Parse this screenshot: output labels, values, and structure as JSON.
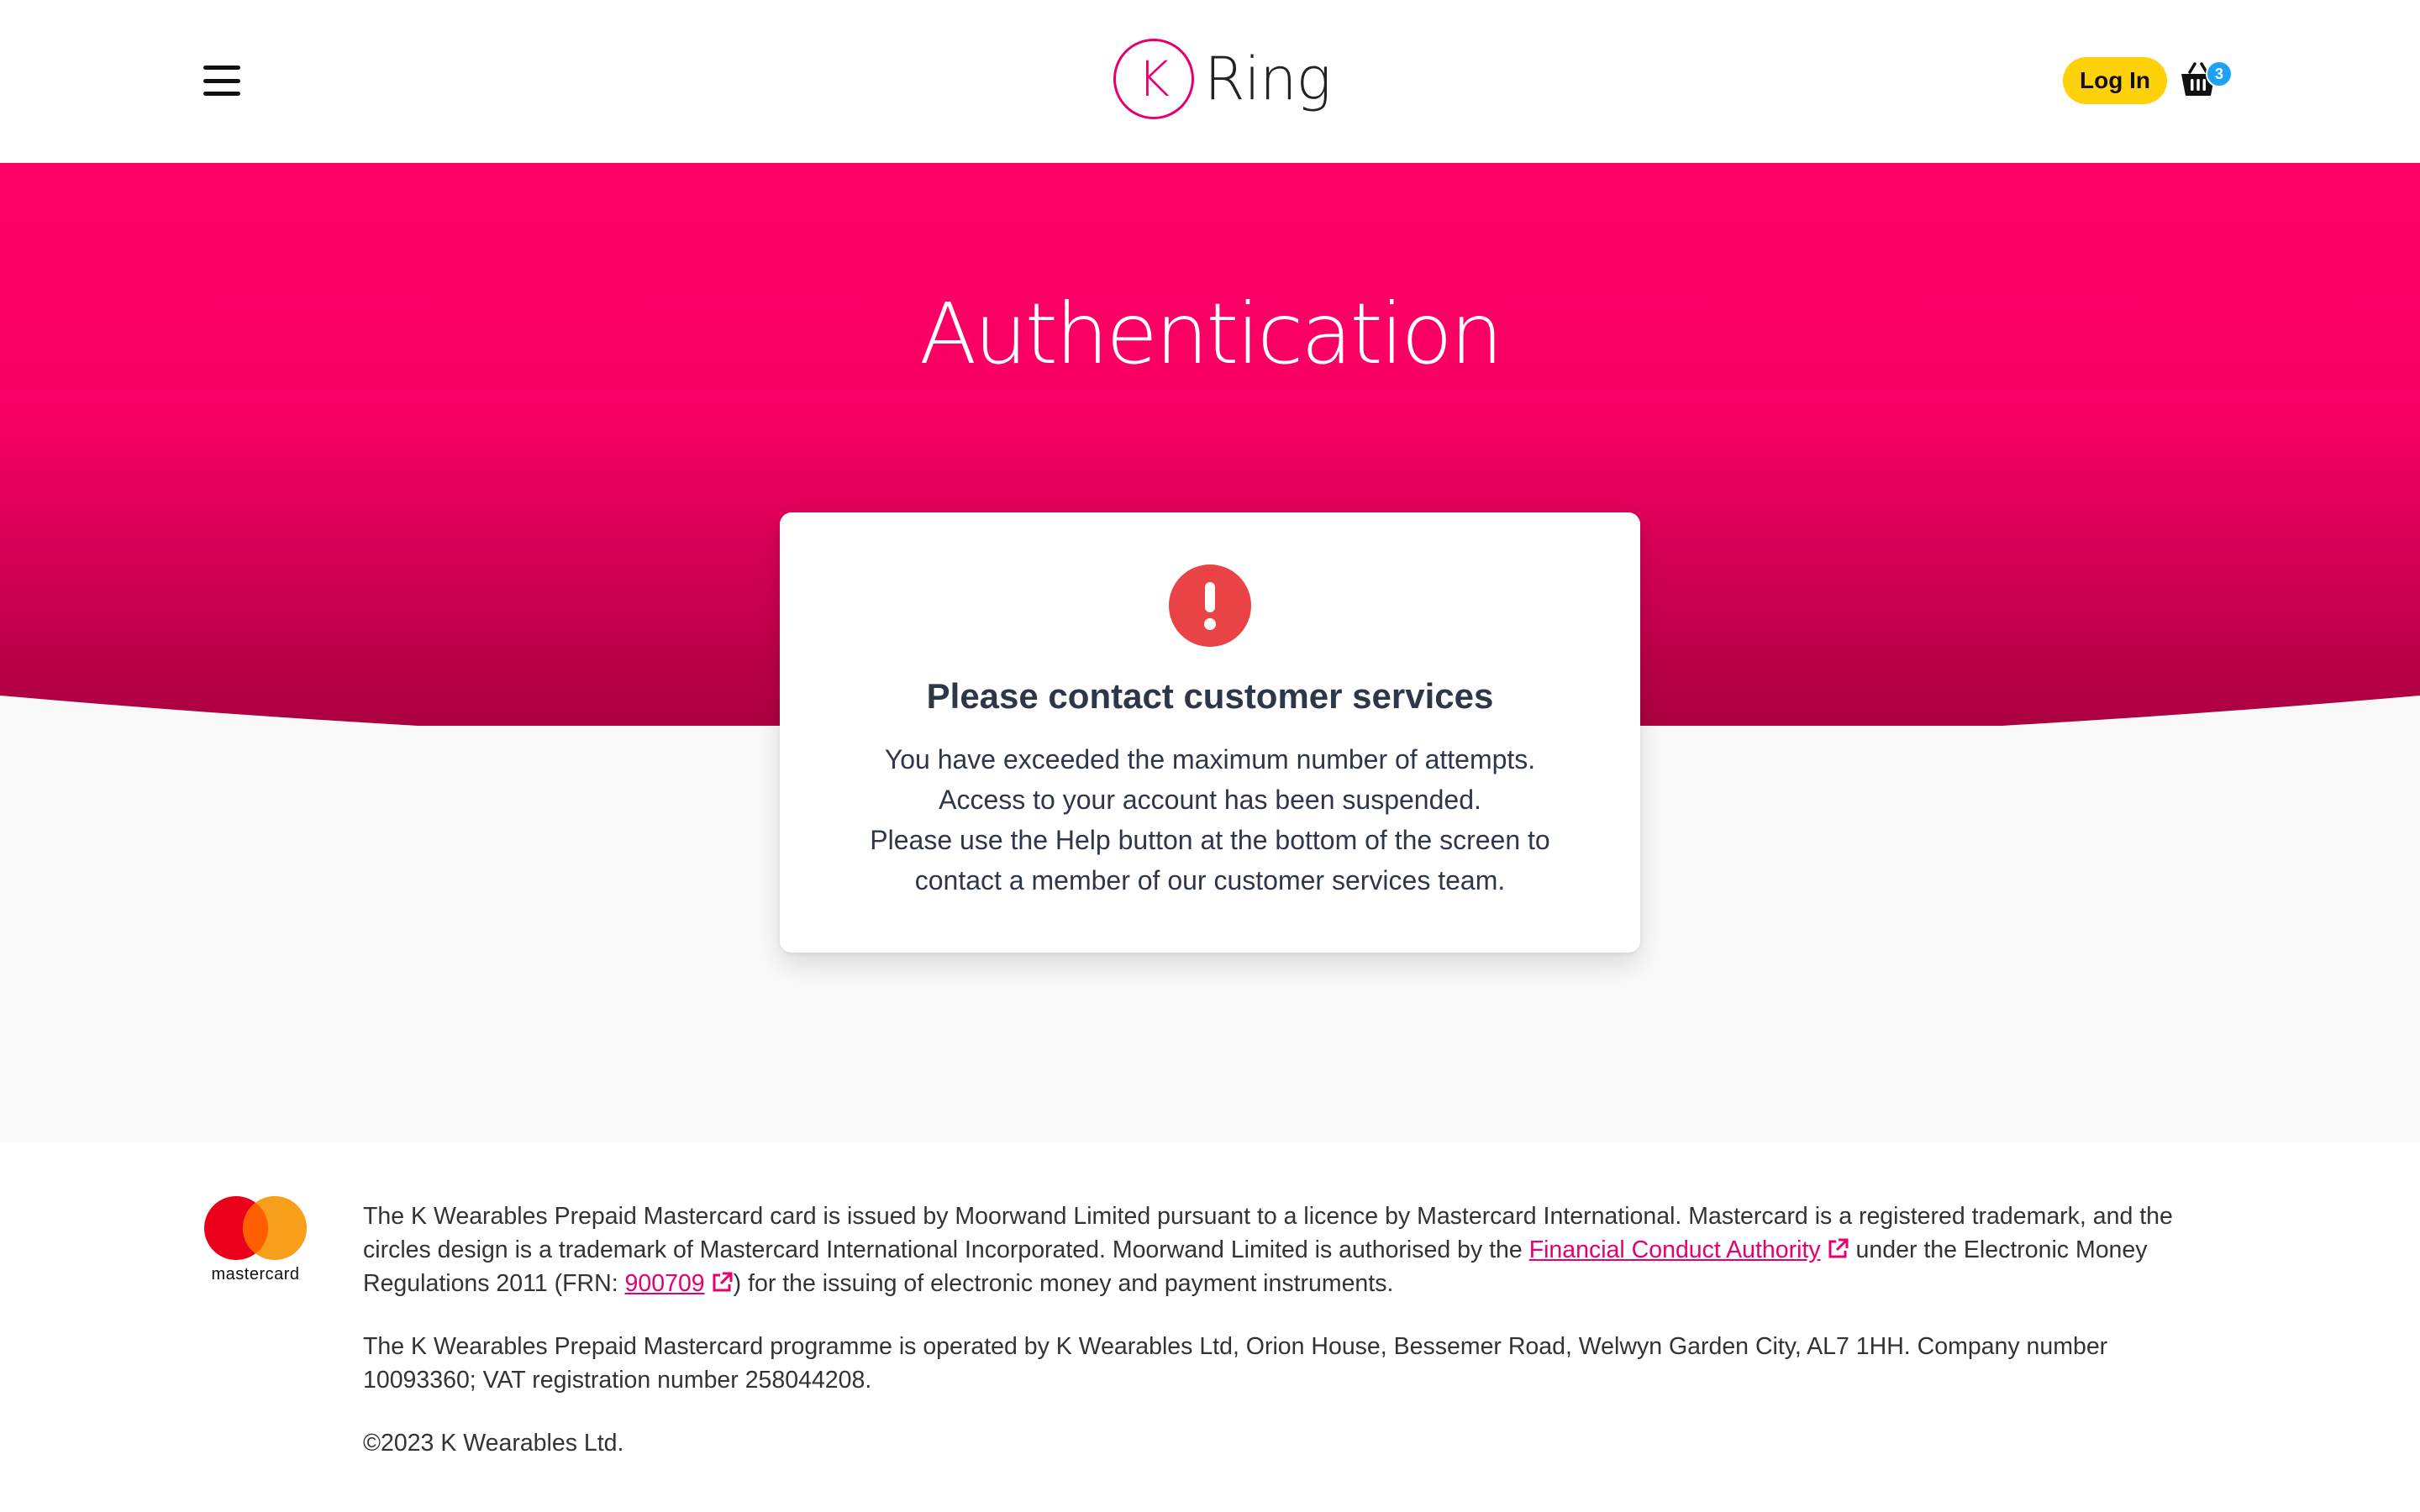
{
  "header": {
    "logo_letter": "K",
    "logo_text": "Ring",
    "login_label": "Log In",
    "cart_count": "3"
  },
  "hero": {
    "title": "Authentication"
  },
  "card": {
    "title": "Please contact customer services",
    "body_lines": [
      "You have exceeded the maximum number of attempts.",
      "Access to your account has been suspended.",
      "Please use the Help button at the bottom of the screen to",
      "contact a member of our customer services team."
    ]
  },
  "footer": {
    "mastercard_label": "mastercard",
    "para1_a": "The K Wearables Prepaid Mastercard card is issued by Moorwand Limited pursuant to a licence by Mastercard International. Mastercard is a registered trademark, and the circles design is a trademark of Mastercard International Incorporated. Moorwand Limited is authorised by the ",
    "fca_link": "Financial Conduct Authority",
    "para1_b": " under the Electronic Money Regulations 2011 (FRN: ",
    "frn_link": "900709",
    "para1_c": ") for the issuing of electronic money and payment instruments.",
    "para2": "The K Wearables Prepaid Mastercard programme is operated by K Wearables Ltd, Orion House, Bessemer Road, Welwyn Garden City, AL7 1HH. Company number 10093360; VAT registration number 258044208.",
    "copyright": "©2023 K Wearables Ltd."
  },
  "colors": {
    "brand_pink": "#ff0066",
    "brand_pink_dark": "#a8003f",
    "login_yellow": "#ffd10a",
    "badge_blue": "#1da1f2",
    "alert_red": "#ea4346",
    "link_pink": "#e6006e"
  },
  "icons": {
    "menu": "hamburger-menu-icon",
    "cart": "shopping-basket-icon",
    "alert": "exclamation-icon",
    "external": "external-link-icon"
  }
}
